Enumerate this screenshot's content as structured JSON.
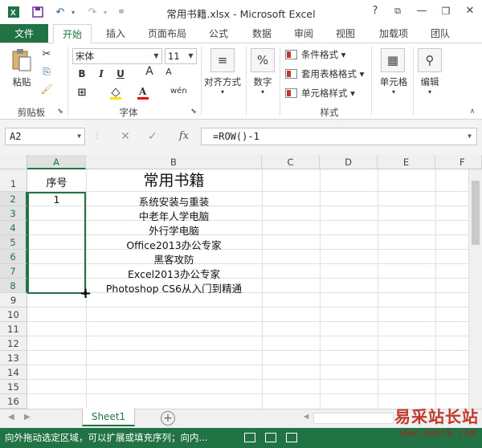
{
  "window": {
    "title": "常用书籍.xlsx - Microsoft Excel"
  },
  "title_controls": {
    "help": "?",
    "ribbon_opts": "⧉",
    "minimize": "—",
    "restore": "❐",
    "close": "✕"
  },
  "tabs": {
    "file": "文件",
    "items": [
      "开始",
      "插入",
      "页面布局",
      "公式",
      "数据",
      "审阅",
      "视图",
      "加载项",
      "团队"
    ]
  },
  "ribbon": {
    "clipboard": {
      "paste": "粘贴",
      "group": "剪贴板"
    },
    "font": {
      "name": "宋体",
      "size": "11",
      "bold": "B",
      "italic": "I",
      "underline": "U",
      "group": "字体"
    },
    "alignment": {
      "label": "对齐方式"
    },
    "number": {
      "label": "数字"
    },
    "styles": {
      "conditional": "条件格式",
      "table": "套用表格格式",
      "cell": "单元格样式",
      "group": "样式"
    },
    "cells": {
      "label": "单元格"
    },
    "editing": {
      "label": "编辑"
    }
  },
  "formula_bar": {
    "name_box": "A2",
    "cancel": "✕",
    "enter": "✓",
    "fx": "fx",
    "formula": "=ROW()-1"
  },
  "grid": {
    "columns": [
      "A",
      "B",
      "C",
      "D",
      "E",
      "F"
    ],
    "rows": [
      "1",
      "2",
      "3",
      "4",
      "5",
      "6",
      "7",
      "8",
      "9",
      "10",
      "11",
      "12",
      "13",
      "14",
      "15",
      "16"
    ],
    "selected_col": "A",
    "cells": {
      "a1": "序号",
      "b1": "常用书籍",
      "a2": "1",
      "b_items": [
        "系统安装与重装",
        "中老年人学电脑",
        "外行学电脑",
        "Office2013办公专家",
        "黑客攻防",
        "Excel2013办公专家",
        "Photoshop CS6从入门到精通"
      ]
    }
  },
  "sheets": {
    "tabs": [
      "Sheet1"
    ],
    "add": "+"
  },
  "status": {
    "message": "向外拖动选定区域，可以扩展或填充序列；向内..."
  },
  "watermark": {
    "text": "易采站长站",
    "url": "www.easck.com"
  },
  "colors": {
    "excel_green": "#217346",
    "watermark_red": "#c0392b"
  }
}
